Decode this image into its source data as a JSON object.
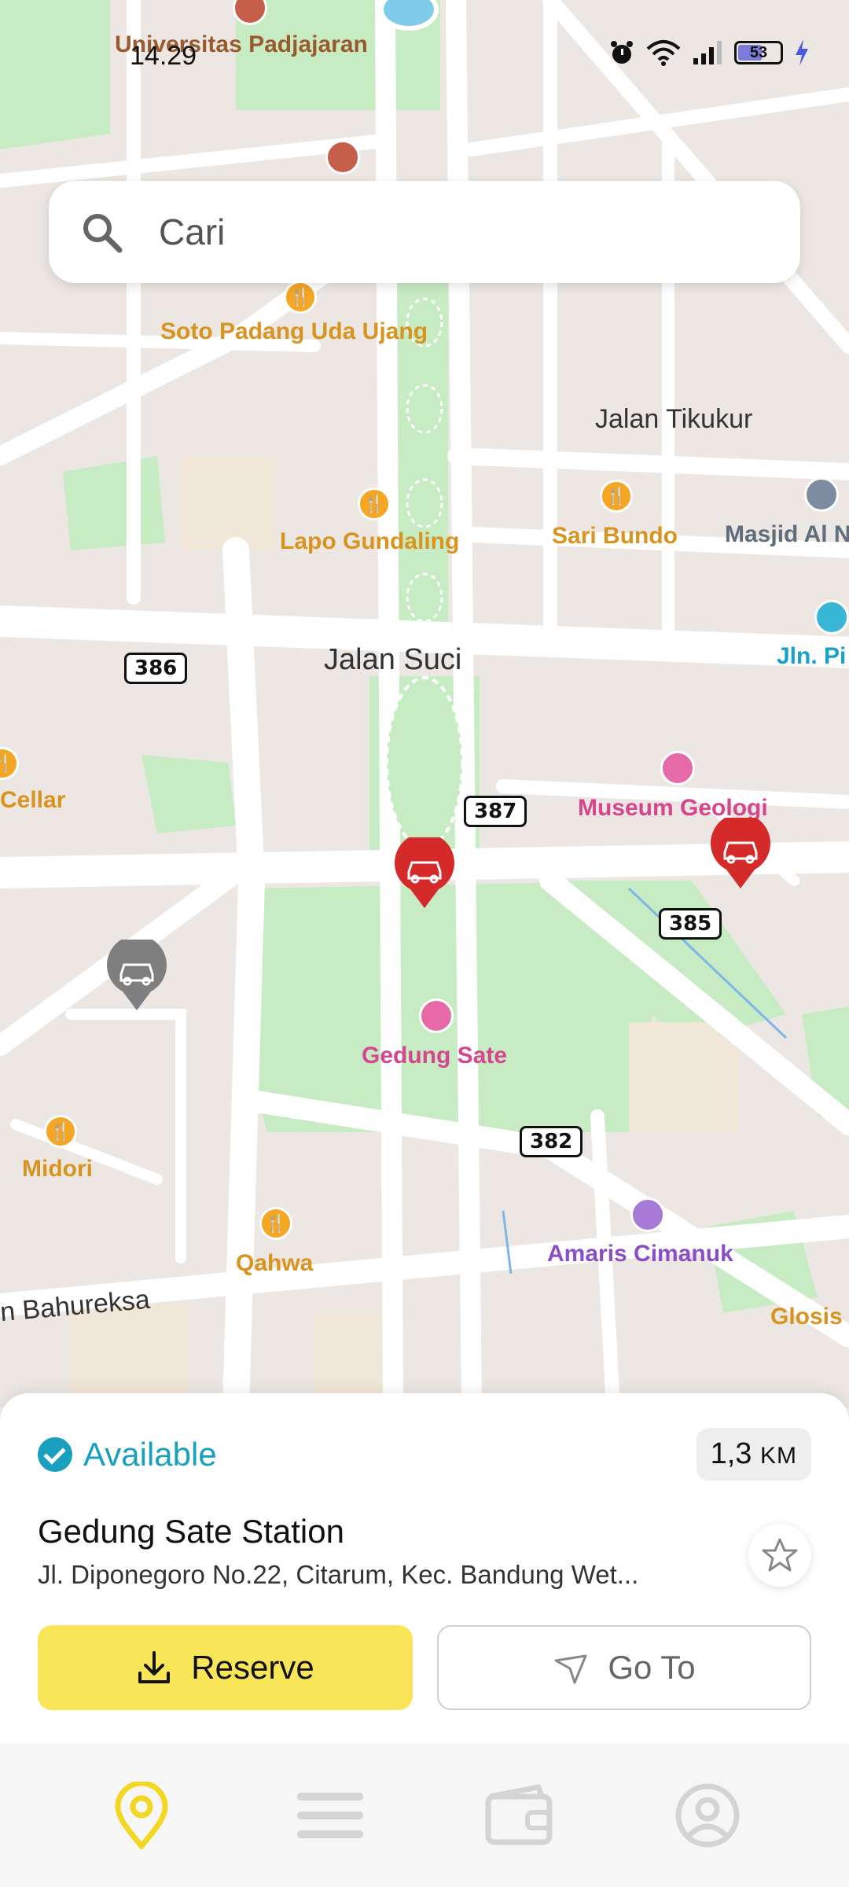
{
  "status_bar": {
    "time": "14.29",
    "battery": "53"
  },
  "search": {
    "placeholder": "Cari"
  },
  "map": {
    "pois": {
      "unpad": "Universitas Padjajaran",
      "soto": "Soto Padang Uda Ujang",
      "tikukur": "Jalan Tikukur",
      "lapo": "Lapo Gundaling",
      "sari": "Sari Bundo",
      "masjid": "Masjid Al N",
      "suci": "Jalan Suci",
      "jln": "Jln. Pi",
      "cellar": "Cellar",
      "museum": "Museum Geologi",
      "gedung": "Gedung Sate",
      "midori": "Midori",
      "qahwa": "Qahwa",
      "amaris": "Amaris Cimanuk",
      "bahureksa": "n Bahureksa",
      "glosis": "Glosis"
    },
    "road_shields": {
      "r386": "386",
      "r387": "387",
      "r385": "385",
      "r382": "382"
    },
    "markers": [
      "ev-station-red",
      "ev-station-red",
      "ev-station-gray"
    ]
  },
  "station": {
    "status": "Available",
    "distance_value": "1,3",
    "distance_unit": "KM",
    "name": "Gedung Sate Station",
    "address": "Jl. Diponegoro No.22, Citarum, Kec. Bandung Wet..."
  },
  "actions": {
    "reserve": "Reserve",
    "goto": "Go To"
  },
  "nav": {
    "items": [
      "map-pin-icon",
      "list-icon",
      "wallet-icon",
      "profile-icon"
    ],
    "active": 0
  },
  "colors": {
    "accent_yellow": "#f8e558",
    "available_teal": "#19a0c0",
    "marker_red": "#d42a2a",
    "marker_gray": "#7f7f7f"
  }
}
